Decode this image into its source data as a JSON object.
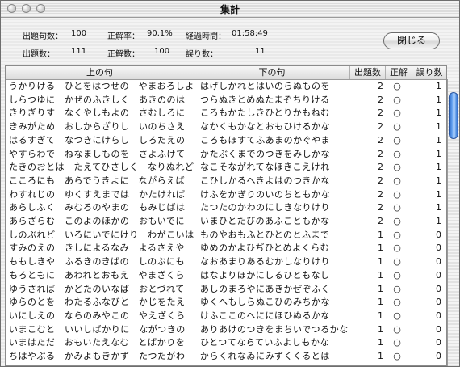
{
  "window": {
    "title": "集計"
  },
  "stats": {
    "questions_label": "出題句数：",
    "questions_value": "100",
    "accuracy_label": "正解率：",
    "accuracy_value": "90.1%",
    "elapsed_label": "経過時間：",
    "elapsed_value": "01:58:49",
    "asked_label": "出題数：",
    "asked_value": "111",
    "correct_label": "正解数：",
    "correct_value": "100",
    "wrong_label": "誤り数：",
    "wrong_value": "11"
  },
  "buttons": {
    "close_label": "閉じる"
  },
  "table": {
    "columns": [
      "上の句",
      "下の句",
      "出題数",
      "正解",
      "誤り数"
    ],
    "rows": [
      [
        "うかりける　ひとをはつせの　やまおろしよ",
        "はげしかれとはいのらぬものを",
        "2",
        "○",
        "1"
      ],
      [
        "しらつゆに　かぜのふきしく　あきののは",
        "つらぬきとめぬたまぞちりける",
        "2",
        "○",
        "1"
      ],
      [
        "きりぎりす　なくやしもよの　さむしろに",
        "ころもかたしきひとりかもねむ",
        "2",
        "○",
        "1"
      ],
      [
        "きみがため　おしからざりし　いのちさえ",
        "なかくもかなとおもひけるかな",
        "2",
        "○",
        "1"
      ],
      [
        "はるすぎて　なつきにけらし　しろたえの",
        "ころもほすてふあまのかぐやま",
        "2",
        "○",
        "1"
      ],
      [
        "やすらわで　ねなましものを　さよふけて",
        "かたぶくまでのつきをみしかな",
        "2",
        "○",
        "1"
      ],
      [
        "たきのおとは　たえてひさしく　なりぬれど",
        "なこそながれてなほきこえけれ",
        "2",
        "○",
        "1"
      ],
      [
        "こころにも　あらでうきよに　ながらえば",
        "こひしかるへきよはのつきかな",
        "2",
        "○",
        "1"
      ],
      [
        "わすれじの　ゆくすえまでは　かたければ",
        "けふをかぎりのいのちともかな",
        "2",
        "○",
        "1"
      ],
      [
        "あらしふく　みむろのやまの　もみじばは",
        "たつたのかわのにしきなりけり",
        "2",
        "○",
        "1"
      ],
      [
        "あらざらむ　このよのほかの　おもいでに",
        "いまひとたびのあふこともかな",
        "2",
        "○",
        "1"
      ],
      [
        "しのぶれど　いろにいでにけり　わがこいは",
        "ものやおもふとひとのとふまで",
        "1",
        "○",
        "0"
      ],
      [
        "すみのえの　きしによるなみ　よるさえや",
        "ゆめのかよひぢひとめよくらむ",
        "1",
        "○",
        "0"
      ],
      [
        "ももしきや　ふるきのきばの　しのぶにも",
        "なおあまりあるむかしなりけり",
        "1",
        "○",
        "0"
      ],
      [
        "もろともに　あわれとおもえ　やまざくら",
        "はなよりほかにしるひともなし",
        "1",
        "○",
        "0"
      ],
      [
        "ゆうされば　かどたのいなば　おとづれて",
        "あしのまろやにあきかぜぞふく",
        "1",
        "○",
        "0"
      ],
      [
        "ゆらのとを　わたるふなびと　かじをたえ",
        "ゆくへもしらぬこひのみちかな",
        "1",
        "○",
        "0"
      ],
      [
        "いにしえの　ならのみやこの　やえざくら",
        "けふここのへににほひぬるかな",
        "1",
        "○",
        "0"
      ],
      [
        "いまこむと　いいしばかりに　ながつきの",
        "ありあけのつきをまちいでつるかな",
        "1",
        "○",
        "0"
      ],
      [
        "いまはただ　おもいたえなむ　とばかりを",
        "ひとつてならていふよしもかな",
        "1",
        "○",
        "0"
      ],
      [
        "ちはやぶる　かみよもきかず　たつたがわ",
        "からくれなゐにみずくくるとは",
        "1",
        "○",
        "0"
      ],
      [
        "ちぎりきな　かたみにそでを　しぼりつつ",
        "すゑのまつやまなみこさしとは",
        "1",
        "○",
        "0"
      ]
    ]
  }
}
